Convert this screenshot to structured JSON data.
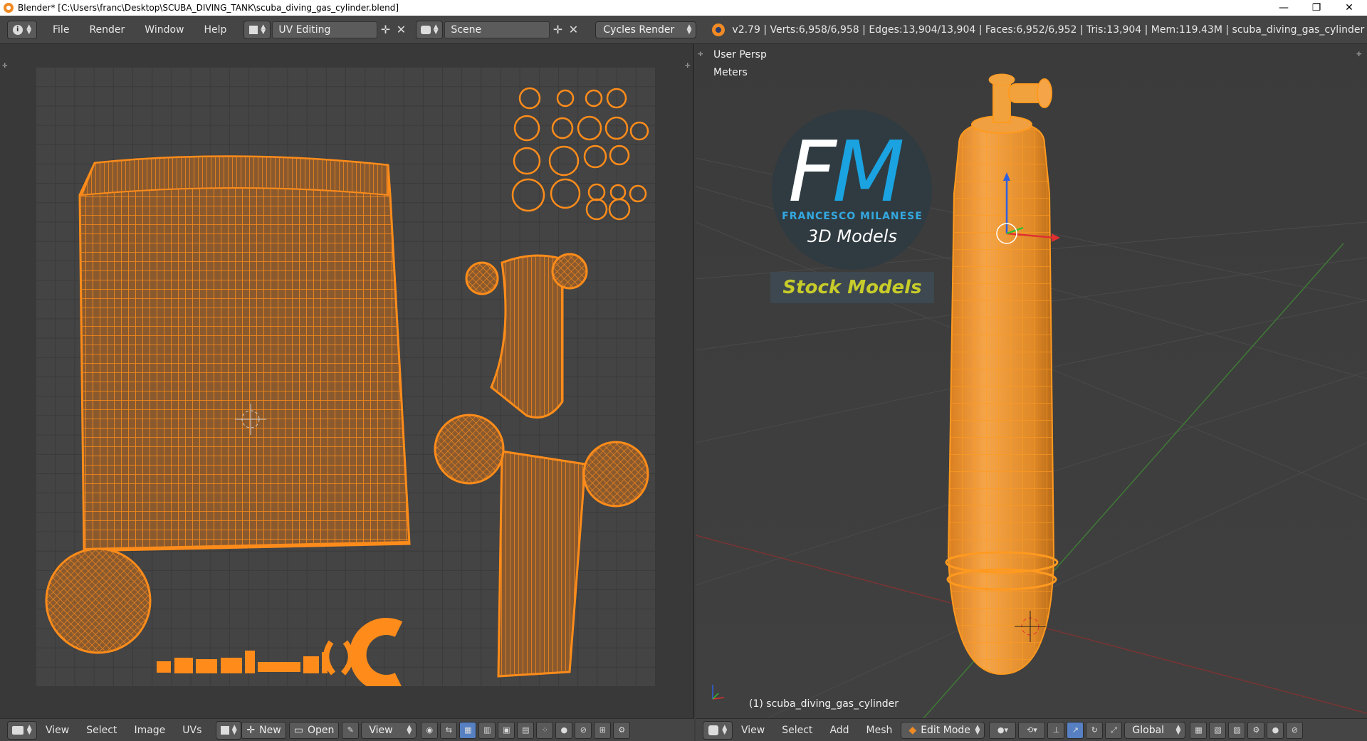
{
  "window": {
    "title": "Blender* [C:\\Users\\franc\\Desktop\\SCUBA_DIVING_TANK\\scuba_diving_gas_cylinder.blend]",
    "minimize": "—",
    "restore": "❐",
    "close": "✕"
  },
  "info_header": {
    "menus": [
      "File",
      "Render",
      "Window",
      "Help"
    ],
    "screen_layout": "UV Editing",
    "scene": "Scene",
    "render_engine": "Cycles Render",
    "stats": "v2.79 | Verts:6,958/6,958 | Edges:13,904/13,904 | Faces:6,952/6,952 | Tris:13,904 | Mem:119.43M | scuba_diving_gas_cylinder"
  },
  "uv_editor": {
    "menus": [
      "View",
      "Select",
      "Image",
      "UVs"
    ],
    "new_label": "New",
    "open_label": "Open",
    "view_label": "View",
    "uv_color": "#ff8c1a",
    "grid_color": "#444444"
  },
  "viewport": {
    "view_name": "User Persp",
    "units": "Meters",
    "object_label": "(1) scuba_diving_gas_cylinder",
    "menus": [
      "View",
      "Select",
      "Add",
      "Mesh"
    ],
    "mode": "Edit Mode",
    "orientation": "Global",
    "mesh_color": "#f59a2c"
  },
  "logo": {
    "letter_f": "F",
    "letter_m": "M",
    "name": "FRANCESCO MILANESE",
    "subtitle": "3D Models",
    "stock": "Stock Models",
    "accent": "#1aa3e0",
    "stock_color": "#c7cc2a"
  },
  "icons": {
    "info": "info-icon",
    "blender": "blender-logo-icon",
    "cursor": "3d-cursor-icon"
  }
}
